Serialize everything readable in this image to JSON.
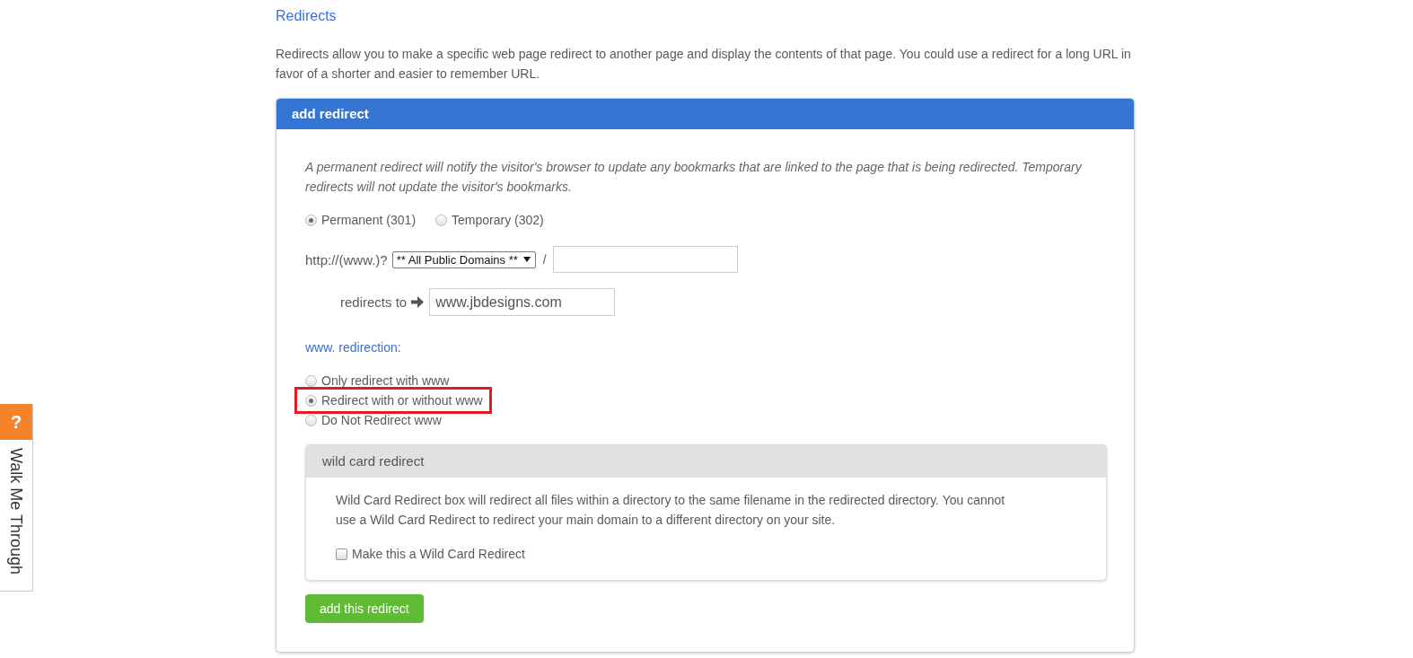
{
  "page": {
    "title": "Redirects",
    "intro": "Redirects allow you to make a specific web page redirect to another page and display the contents of that page. You could use a redirect for a long URL in favor of a shorter and easier to remember URL."
  },
  "panel": {
    "title": "add redirect",
    "note": "A permanent redirect will notify the visitor's browser to update any bookmarks that are linked to the page that is being redirected. Temporary redirects will not update the visitor's bookmarks.",
    "redirect_types": [
      {
        "label": "Permanent (301)",
        "selected": true
      },
      {
        "label": "Temporary (302)",
        "selected": false
      }
    ],
    "source": {
      "prefix": "http://(www.)?",
      "domain_select": "** All Public Domains **",
      "separator": "/"
    },
    "target": {
      "label": "redirects to",
      "value": "www.jbdesigns.com"
    },
    "www_redirection": {
      "heading": "www. redirection:",
      "options": [
        {
          "label": "Only redirect with www",
          "selected": false,
          "highlighted": false
        },
        {
          "label": "Redirect with or without www",
          "selected": true,
          "highlighted": true
        },
        {
          "label": "Do Not Redirect www",
          "selected": false,
          "highlighted": false
        }
      ]
    },
    "wildcard": {
      "title": "wild card redirect",
      "description": "Wild Card Redirect box will redirect all files within a directory to the same filename in the redirected directory. You cannot use a Wild Card Redirect to redirect your main domain to a different directory on your site.",
      "checkbox": {
        "label": "Make this a Wild Card Redirect",
        "checked": false
      }
    },
    "submit_button": "add this redirect"
  },
  "help_tab": {
    "symbol": "?",
    "label": "Walk Me Through"
  }
}
